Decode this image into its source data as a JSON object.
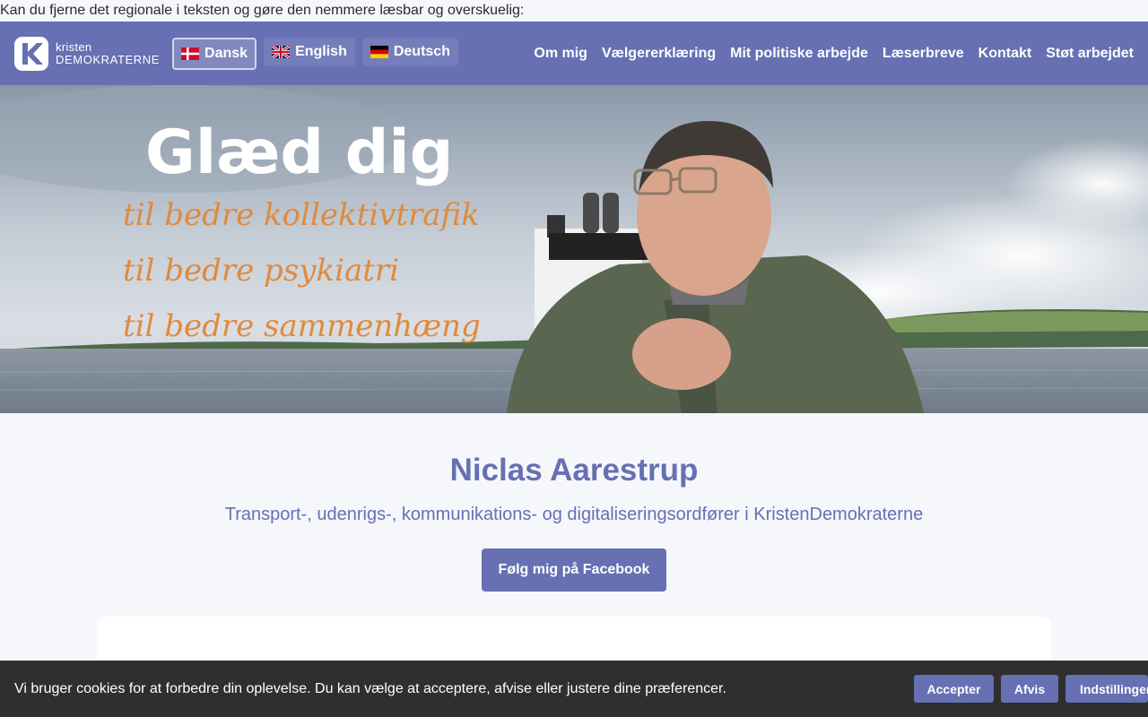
{
  "preface_text": "Kan du fjerne det regionale i teksten og gøre den nemmere læsbar og overskuelig:",
  "logo": {
    "line1": "kristen",
    "line2": "DEMOKRATERNE",
    "letter": "K"
  },
  "languages": [
    {
      "label": "Dansk",
      "flag": "dk-flag-icon",
      "active": true
    },
    {
      "label": "English",
      "flag": "uk-flag-icon",
      "active": false
    },
    {
      "label": "Deutsch",
      "flag": "de-flag-icon",
      "active": false
    }
  ],
  "nav": [
    "Om mig",
    "Vælgererklæring",
    "Mit politiske arbejde",
    "Læserbreve",
    "Kontakt",
    "Støt arbejdet"
  ],
  "hero": {
    "headline": "Glæd dig",
    "lines": [
      "til bedre kollektivtrafik",
      "til bedre psykiatri",
      "til bedre sammenhæng"
    ]
  },
  "profile": {
    "name": "Niclas Aarestrup",
    "subtitle": "Transport-, udenrigs-, kommunikations- og digitaliseringsordfører i KristenDemokraterne",
    "facebook_button": "Følg mig på Facebook"
  },
  "cookie": {
    "text": "Vi bruger cookies for at forbedre din oplevelse. Du kan vælge at acceptere, afvise eller justere dine præferencer.",
    "accept": "Accepter",
    "reject": "Afvis",
    "settings": "Indstillinger"
  },
  "colors": {
    "brand": "#6670b3",
    "hero_script": "#e08a3c",
    "cookie_bg": "#2f2f2f"
  }
}
